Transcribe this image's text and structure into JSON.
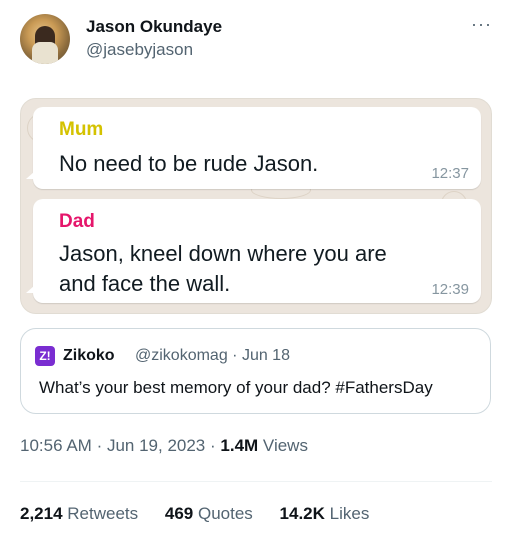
{
  "author": {
    "name": "Jason Okundaye",
    "handle": "@jasebyjason"
  },
  "more_icon": "more-horizontal-icon",
  "chat": {
    "messages": [
      {
        "sender": "Mum",
        "sender_color": "#d4c200",
        "text_lines": [
          "No need to be rude Jason."
        ],
        "time": "12:37"
      },
      {
        "sender": "Dad",
        "sender_color": "#e5166b",
        "text_lines": [
          "Jason, kneel down where you are",
          "and face the wall."
        ],
        "time": "12:39"
      }
    ]
  },
  "quoted": {
    "logo_text": "Z!",
    "name": "Zikoko",
    "meta": "@zikokomag · Jun 18",
    "text": "What’s your best memory of your dad? #FathersDay"
  },
  "meta": {
    "time": "10:56 AM",
    "date": "Jun 19, 2023",
    "views_count": "1.4M",
    "views_label": "Views"
  },
  "stats": {
    "retweets": {
      "count": "2,214",
      "label": "Retweets"
    },
    "quotes": {
      "count": "469",
      "label": "Quotes"
    },
    "likes": {
      "count": "14.2K",
      "label": "Likes"
    }
  }
}
